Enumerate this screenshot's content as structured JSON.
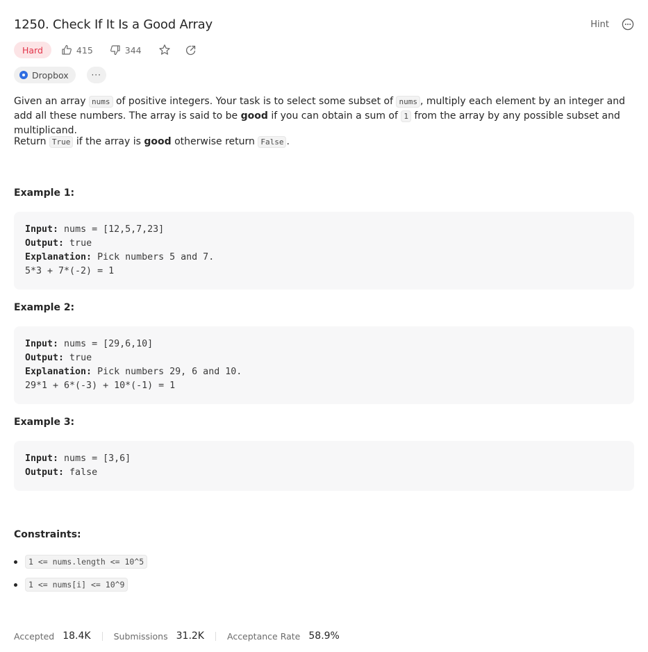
{
  "problem": {
    "title": "1250. Check If It Is a Good Array",
    "hint_label": "Hint",
    "difficulty": "Hard",
    "likes": "415",
    "dislikes": "344",
    "company": "Dropbox",
    "more_label": "···"
  },
  "description": {
    "p1_a": "Given an array ",
    "p1_code1": "nums",
    "p1_b": " of positive integers. Your task is to select some subset of ",
    "p1_code2": "nums",
    "p1_c": ", multiply each element by an integer and add all these numbers. The array is said to be ",
    "p1_bold": "good",
    "p1_d": " if you can obtain a sum of ",
    "p1_code3": "1",
    "p1_e": " from the array by any possible subset and multiplicand.",
    "p2_a": "Return ",
    "p2_code1": "True",
    "p2_b": " if the array is ",
    "p2_bold": "good",
    "p2_c": " otherwise return ",
    "p2_code2": "False",
    "p2_d": "."
  },
  "examples": [
    {
      "title": "Example 1:",
      "input_label": "Input:",
      "input": " nums = [12,5,7,23]",
      "output_label": "Output:",
      "output": " true",
      "explanation_label": "Explanation:",
      "explanation": " Pick numbers 5 and 7.",
      "extra": "5*3 + 7*(-2) = 1"
    },
    {
      "title": "Example 2:",
      "input_label": "Input:",
      "input": " nums = [29,6,10]",
      "output_label": "Output:",
      "output": " true",
      "explanation_label": "Explanation:",
      "explanation": " Pick numbers 29, 6 and 10.",
      "extra": "29*1 + 6*(-3) + 10*(-1) = 1"
    },
    {
      "title": "Example 3:",
      "input_label": "Input:",
      "input": " nums = [3,6]",
      "output_label": "Output:",
      "output": " false"
    }
  ],
  "constraints": {
    "title": "Constraints:",
    "items": [
      "1 <= nums.length <= 10^5",
      "1 <= nums[i] <= 10^9"
    ]
  },
  "stats": {
    "accepted_label": "Accepted",
    "accepted_value": "18.4K",
    "submissions_label": "Submissions",
    "submissions_value": "31.2K",
    "rate_label": "Acceptance Rate",
    "rate_value": "58.9%"
  }
}
